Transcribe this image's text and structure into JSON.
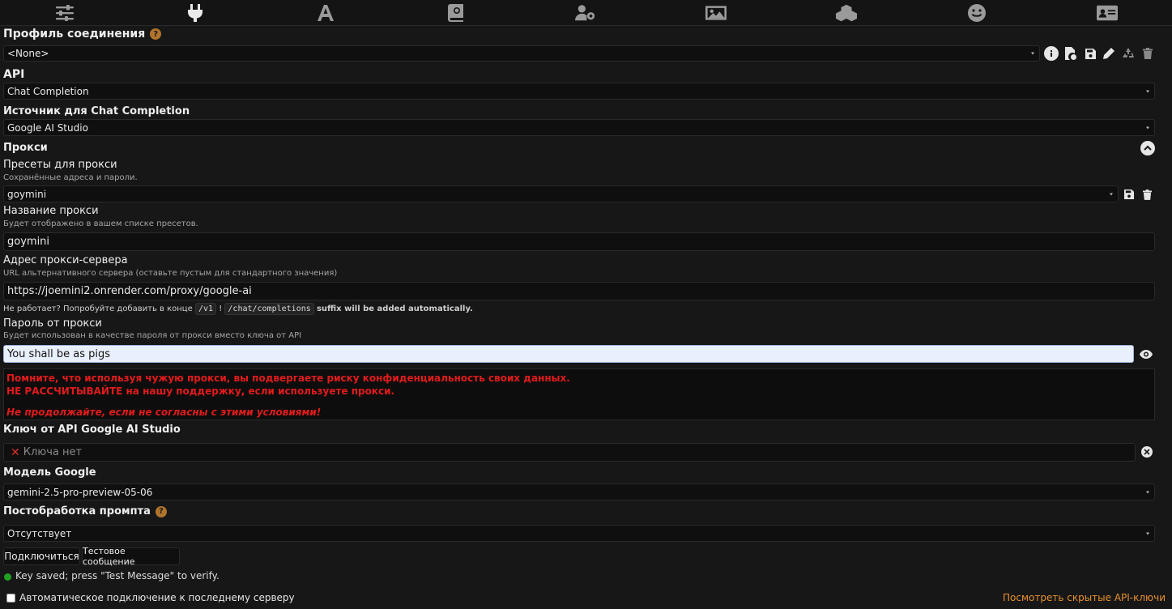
{
  "topbar": {
    "icons": [
      "sliders-icon",
      "plug-icon",
      "font-icon",
      "book-icon",
      "user-gear-icon",
      "image-icon",
      "cubes-icon",
      "smile-icon",
      "id-card-icon"
    ]
  },
  "connection_profile": {
    "title": "Профиль соединения",
    "help": "?",
    "value": "<None>"
  },
  "api": {
    "title": "API",
    "value": "Chat Completion"
  },
  "source": {
    "title": "Источник для Chat Completion",
    "value": "Google AI Studio"
  },
  "proxy": {
    "title": "Прокси",
    "presets": {
      "label": "Пресеты для прокси",
      "sub": "Сохранённые адреса и пароли.",
      "value": "goymini"
    },
    "name": {
      "label": "Название прокси",
      "sub": "Будет отображено в вашем списке пресетов.",
      "value": "goymini"
    },
    "address": {
      "label": "Адрес прокси-сервера",
      "sub": "URL альтернативного сервера (оставьте пустым для стандартного значения)",
      "value": "https://joemini2.onrender.com/proxy/google-ai"
    },
    "hint": {
      "prefix": "Не работает? Попробуйте добавить в конце",
      "code1": "/v1",
      "sep": "!",
      "code2": "/chat/completions",
      "suffix": "suffix will be added automatically."
    },
    "password": {
      "label": "Пароль от прокси",
      "sub": "Будет использован в качестве пароля от прокси вместо ключа от API",
      "value": "You shall be as pigs"
    },
    "warning": {
      "line1": "Помните, что используя чужую прокси, вы подвергаете риску конфиденциальность своих данных.",
      "line2": "НЕ РАССЧИТЫВАЙТЕ на нашу поддержку, если используете прокси.",
      "line3": "Не продолжайте, если не согласны с этими условиями!"
    }
  },
  "api_key": {
    "title": "Ключ от API Google AI Studio",
    "placeholder": "Ключа нет"
  },
  "model": {
    "title": "Модель Google",
    "value": "gemini-2.5-pro-preview-05-06"
  },
  "postprocess": {
    "title": "Постобработка промпта",
    "help": "?",
    "value": "Отсутствует"
  },
  "buttons": {
    "connect": "Подключиться",
    "test": "Тестовое сообщение"
  },
  "status": {
    "text": "Key saved; press \"Test Message\" to verify.",
    "color": "#1fa31f"
  },
  "footer": {
    "auto_connect": "Автоматическое подключение к последнему серверу",
    "hidden_keys_link": "Посмотреть скрытые API-ключи"
  },
  "colors": {
    "accent": "#e8902e",
    "warning": "#e21b1b",
    "help_badge": "#b0742d"
  }
}
